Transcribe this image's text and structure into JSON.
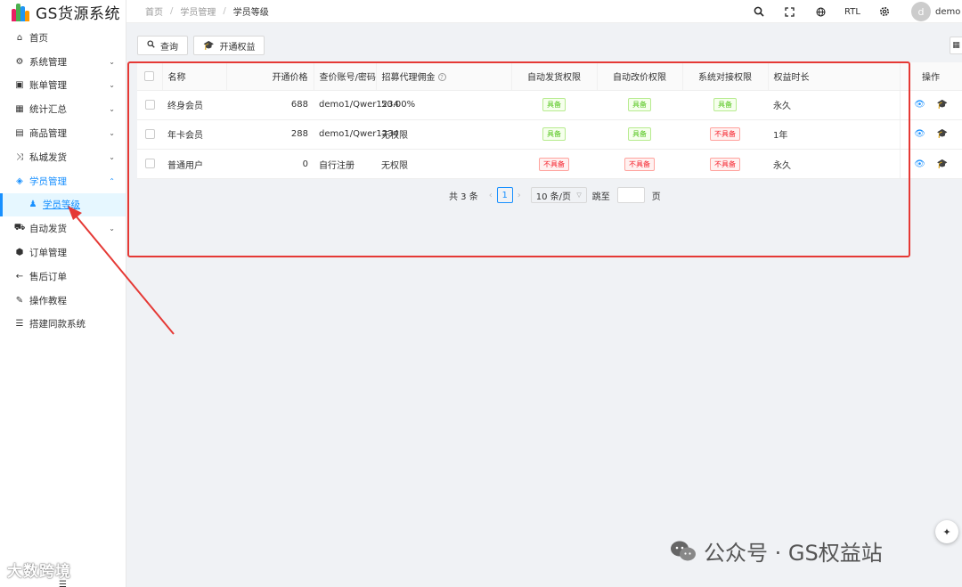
{
  "app": {
    "title": "GS货源系统"
  },
  "sidebar": {
    "items": [
      {
        "label": "首页",
        "icon": "home-icon",
        "glyph": "⌂",
        "arrow": ""
      },
      {
        "label": "系统管理",
        "icon": "gears-icon",
        "glyph": "⚙",
        "arrow": "⌄"
      },
      {
        "label": "账单管理",
        "icon": "money-icon",
        "glyph": "▣",
        "arrow": "⌄"
      },
      {
        "label": "统计汇总",
        "icon": "table-icon",
        "glyph": "▦",
        "arrow": "⌄"
      },
      {
        "label": "商品管理",
        "icon": "calendar-icon",
        "glyph": "▤",
        "arrow": "⌄"
      },
      {
        "label": "私城发货",
        "icon": "shuffle-icon",
        "glyph": "⤨",
        "arrow": "⌄"
      },
      {
        "label": "学员管理",
        "icon": "diamond-icon",
        "glyph": "◈",
        "arrow": "⌃"
      },
      {
        "label": "学员等级",
        "icon": "person-icon",
        "glyph": "♟",
        "arrow": ""
      },
      {
        "label": "自动发货",
        "icon": "car-icon",
        "glyph": "⛟",
        "arrow": "⌄"
      },
      {
        "label": "订单管理",
        "icon": "cube-icon",
        "glyph": "⬢",
        "arrow": ""
      },
      {
        "label": "售后订单",
        "icon": "arrow-left-icon",
        "glyph": "←",
        "arrow": ""
      },
      {
        "label": "操作教程",
        "icon": "language-icon",
        "glyph": "✎",
        "arrow": ""
      },
      {
        "label": "搭建同款系统",
        "icon": "list-icon",
        "glyph": "☰",
        "arrow": ""
      }
    ]
  },
  "breadcrumb": {
    "home": "首页",
    "parent": "学员管理",
    "current": "学员等级",
    "sep": "/"
  },
  "header": {
    "rtl": "RTL",
    "avatar_letter": "d",
    "username": "demo"
  },
  "toolbar": {
    "query_label": "查询",
    "open_label": "开通权益"
  },
  "table": {
    "headers": {
      "name": "名称",
      "price": "开通价格",
      "account": "查价账号/密码",
      "commission": "招募代理佣金",
      "auto_ship": "自动发货权限",
      "auto_price": "自动改价权限",
      "api": "系统对接权限",
      "duration": "权益时长",
      "ops": "操作"
    },
    "rows": [
      {
        "name": "终身会员",
        "price": "688",
        "account": "demo1/Qwer1234",
        "commission": "50.00%",
        "auto_ship": "具备",
        "auto_ship_ok": true,
        "auto_price": "具备",
        "auto_price_ok": true,
        "api": "具备",
        "api_ok": true,
        "duration": "永久"
      },
      {
        "name": "年卡会员",
        "price": "288",
        "account": "demo1/Qwer1234",
        "commission": "无权限",
        "auto_ship": "具备",
        "auto_ship_ok": true,
        "auto_price": "具备",
        "auto_price_ok": true,
        "api": "不具备",
        "api_ok": false,
        "duration": "1年"
      },
      {
        "name": "普通用户",
        "price": "0",
        "account": "自行注册",
        "commission": "无权限",
        "auto_ship": "不具备",
        "auto_ship_ok": false,
        "auto_price": "不具备",
        "auto_price_ok": false,
        "api": "不具备",
        "api_ok": false,
        "duration": "永久"
      }
    ]
  },
  "pagination": {
    "total": "共 3 条",
    "page": "1",
    "size": "10 条/页",
    "jump": "跳至",
    "page_unit": "页"
  },
  "colors": {
    "primary": "#1890ff",
    "annotation": "#e53935",
    "success": "#52c41a",
    "danger": "#f5222d"
  },
  "watermarks": {
    "left": "大数跨境",
    "right": "公众号 · GS权益站"
  }
}
